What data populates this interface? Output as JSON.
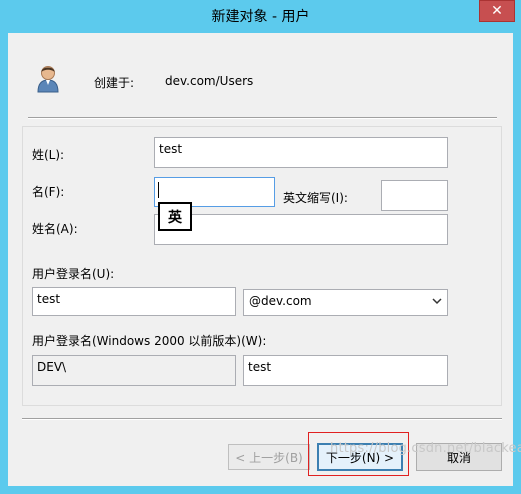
{
  "window": {
    "title": "新建对象 - 用户",
    "close_glyph": "✕"
  },
  "header": {
    "created_in_label": "创建于:",
    "created_in_value": "dev.com/Users"
  },
  "form": {
    "last_name_label": "姓(L):",
    "last_name_value": "test",
    "first_name_label": "名(F):",
    "first_name_value": "",
    "initials_label": "英文缩写(I):",
    "initials_value": "",
    "full_name_label": "姓名(A):",
    "full_name_value": "",
    "ime_indicator": "英",
    "logon_name_label": "用户登录名(U):",
    "logon_name_value": "test",
    "upn_suffix_value": "@dev.com",
    "legacy_logon_label": "用户登录名(Windows 2000 以前版本)(W):",
    "legacy_domain_value": "DEV\\",
    "legacy_logon_value": "test"
  },
  "buttons": {
    "back": "< 上一步(B)",
    "next": "下一步(N) >",
    "cancel": "取消"
  },
  "watermark": "https://blog.csdn.net/blackears",
  "colors": {
    "title_bar": "#5ccaed",
    "close_button": "#c74f50",
    "highlight_box": "#e02020"
  }
}
